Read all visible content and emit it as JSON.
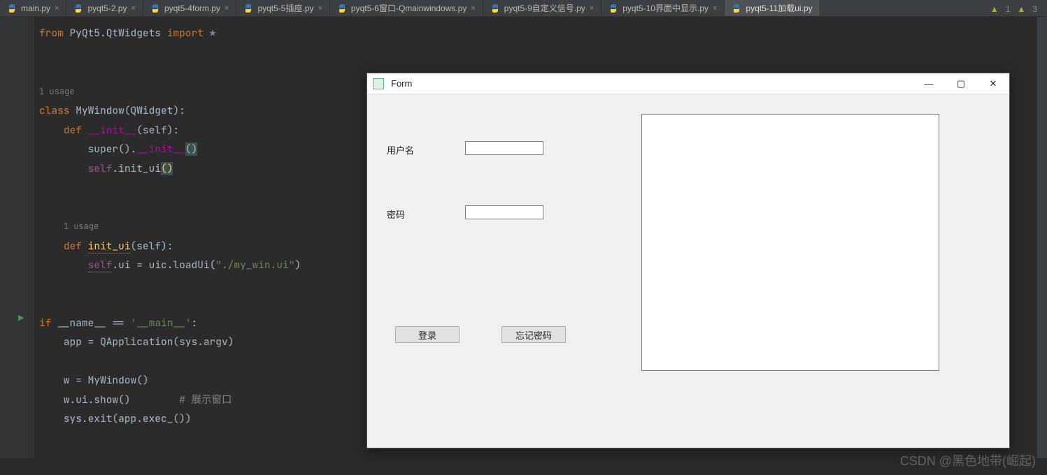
{
  "tabs": [
    {
      "label": "main.py"
    },
    {
      "label": "pyqt5-2.py"
    },
    {
      "label": "pyqt5-4form.py"
    },
    {
      "label": "pyqt5-5插座.py"
    },
    {
      "label": "pyqt5-6窗口-Qmainwindows.py"
    },
    {
      "label": "pyqt5-9自定义信号.py"
    },
    {
      "label": "pyqt5-10界面中显示.py"
    },
    {
      "label": "pyqt5-11加载ui.py"
    }
  ],
  "active_tab_index": 7,
  "annotations": {
    "warnings": "1",
    "errors": "3"
  },
  "usage_text": "1 usage",
  "code": {
    "l1_from": "from ",
    "l1_mod": "PyQt5.QtWidgets ",
    "l1_import": "import ",
    "l1_star": "*",
    "l3_class": "class ",
    "l3_name": "MyWindow",
    "l3_paren": "(QWidget):",
    "l4_def": "def ",
    "l4_name": "__init__",
    "l4_args": "(self):",
    "l5": "super().",
    "l5_init": "__init__",
    "l5_paren": "()",
    "l6_self": "self",
    "l6_rest": ".init_ui",
    "l6_paren": "()",
    "l8_def": "def ",
    "l8_name": "init_ui",
    "l8_args": "(self):",
    "l9_self": "self",
    "l9_rest": ".ui = uic.loadUi(",
    "l9_str": "\"./my_win.ui\"",
    "l9_close": ")",
    "l11_if": "if ",
    "l11_name": "__name__ == ",
    "l11_str": "'__main__'",
    "l11_colon": ":",
    "l12": "    app = QApplication(sys.argv)",
    "l13": "    w = MyWindow()",
    "l14a": "    w.ui.show()        ",
    "l14b": "# 展示窗口",
    "l15": "    sys.exit(app.exec_())"
  },
  "form": {
    "title": "Form",
    "label_user": "用户名",
    "label_pass": "密码",
    "btn_login": "登录",
    "btn_forgot": "忘记密码"
  },
  "watermark": "CSDN @黑色地带(崛起)"
}
